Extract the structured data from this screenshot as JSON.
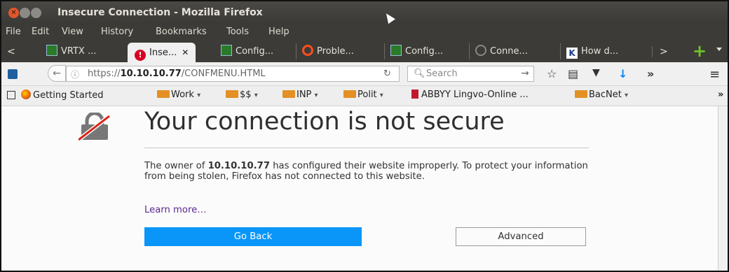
{
  "window": {
    "title": "Insecure Connection - Mozilla Firefox"
  },
  "menubar": {
    "items": [
      "File",
      "Edit",
      "View",
      "History",
      "Bookmarks",
      "Tools",
      "Help"
    ]
  },
  "tabs": [
    {
      "label": "VRTX ...",
      "icon": "green-grid-icon",
      "active": false
    },
    {
      "label": "Inse...",
      "icon": "warning-icon",
      "active": true
    },
    {
      "label": "Config...",
      "icon": "green-grid-icon",
      "active": false
    },
    {
      "label": "Proble...",
      "icon": "ring-icon",
      "active": false
    },
    {
      "label": "Config...",
      "icon": "green-grid-icon",
      "active": false
    },
    {
      "label": "Conne...",
      "icon": "loading-icon",
      "active": false
    },
    {
      "label": "How d...",
      "icon": "k-icon",
      "active": false
    }
  ],
  "navbar": {
    "url_prefix": "https://",
    "url_host": "10.10.10.77",
    "url_path": "/CONFMENU.HTML",
    "search_placeholder": "Search"
  },
  "bookmarks": [
    {
      "label": "Getting Started",
      "type": "firefox",
      "dropdown": false
    },
    {
      "label": "Work",
      "type": "folder",
      "dropdown": true
    },
    {
      "label": "$$",
      "type": "folder",
      "dropdown": true
    },
    {
      "label": "INP",
      "type": "folder",
      "dropdown": true
    },
    {
      "label": "Polit",
      "type": "folder",
      "dropdown": true
    },
    {
      "label": "ABBYY Lingvo-Online ...",
      "type": "book",
      "dropdown": false
    },
    {
      "label": "BacNet",
      "type": "folder",
      "dropdown": true
    }
  ],
  "error_page": {
    "headline": "Your connection is not secure",
    "desc_part1": "The owner of ",
    "desc_host": "10.10.10.77",
    "desc_part2": " has configured their website improperly. To protect your information from being stolen, Firefox has not connected to this website.",
    "learn_more": "Learn more…",
    "go_back": "Go Back",
    "advanced": "Advanced"
  },
  "colors": {
    "primary_button": "#0996f8",
    "learn_more_link": "#5a2891",
    "titlebar": "#3c3b37",
    "close_button": "#e2572c"
  }
}
